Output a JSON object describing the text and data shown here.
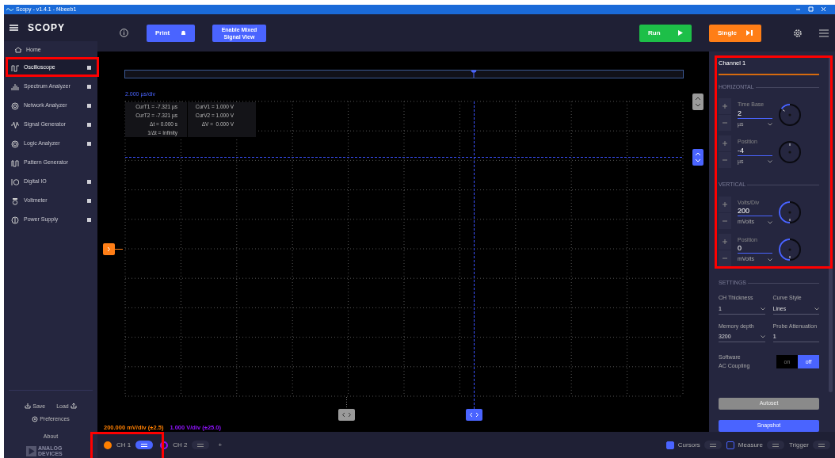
{
  "window": {
    "title": "Scopy - v1.4.1 - f4beeb1"
  },
  "sidebar": {
    "logo": "SCOPY",
    "home": "Home",
    "items": [
      {
        "label": "Oscilloscope",
        "selected": true,
        "indicator": true,
        "kind": "scope"
      },
      {
        "label": "Spectrum Analyzer",
        "selected": false,
        "indicator": true,
        "kind": "spectrum"
      },
      {
        "label": "Network Analyzer",
        "selected": false,
        "indicator": true,
        "kind": "network"
      },
      {
        "label": "Signal Generator",
        "selected": false,
        "indicator": true,
        "kind": "siggen"
      },
      {
        "label": "Logic Analyzer",
        "selected": false,
        "indicator": true,
        "kind": "logic"
      },
      {
        "label": "Pattern Generator",
        "selected": false,
        "indicator": false,
        "kind": "pattern"
      },
      {
        "label": "Digital IO",
        "selected": false,
        "indicator": true,
        "kind": "dio"
      },
      {
        "label": "Voltmeter",
        "selected": false,
        "indicator": true,
        "kind": "voltmeter"
      },
      {
        "label": "Power Supply",
        "selected": false,
        "indicator": true,
        "kind": "power"
      }
    ],
    "save": "Save",
    "load": "Load",
    "preferences": "Preferences",
    "about": "About",
    "vendor": [
      "ANALOG",
      "DEVICES"
    ]
  },
  "toolbar": {
    "print": "Print",
    "mixed_signal": "Enable Mixed Signal View",
    "run": "Run",
    "single": "Single"
  },
  "plot": {
    "time_scale": "2.000 µs/div",
    "cursor_readouts": [
      [
        "CurT1 = -7.321 µs",
        "CurT2 = -7.321 µs",
        "Δt = 0.000 s",
        "1/Δt = Infinity"
      ],
      [
        "CurV1 = 1.000 V",
        "CurV2 = 1.000 V",
        "ΔV =  0.000 V"
      ]
    ],
    "channel_scales": [
      {
        "text": "200.000 mV/div (±2.5)",
        "color": "#ff7f00"
      },
      {
        "text": "1.000 V/div (±25.0)",
        "color": "#9013fe"
      }
    ]
  },
  "panel": {
    "title": "Channel 1",
    "sections": [
      {
        "label": "HORIZONTAL",
        "controls": [
          {
            "label": "Time Base",
            "value": "2",
            "unit": "µs"
          },
          {
            "label": "Position",
            "value": "-4",
            "unit": "µs"
          }
        ]
      },
      {
        "label": "VERTICAL",
        "controls": [
          {
            "label": "Volts/Div",
            "value": "200",
            "unit": "mVolts"
          },
          {
            "label": "Position",
            "value": "0",
            "unit": "mVolts"
          }
        ]
      }
    ],
    "settings_label": "SETTINGS",
    "settings": [
      {
        "label": "CH Thickness",
        "value": "1",
        "kind": "dropdown"
      },
      {
        "label": "Curve Style",
        "value": "Lines",
        "kind": "dropdown"
      },
      {
        "label": "Memory depth",
        "value": "3200",
        "kind": "dropdown"
      },
      {
        "label": "Probe Attenuation",
        "value": "1",
        "kind": "input"
      }
    ],
    "ac_coupling": {
      "label": [
        "Software",
        "AC Coupling"
      ],
      "on_label": "on",
      "off_label": "off",
      "on": false
    },
    "autoset": "Autoset",
    "snapshot": "Snapshot"
  },
  "bottom": {
    "channels": [
      {
        "label": "CH 1",
        "color": "#ff7f00",
        "selected": true
      },
      {
        "label": "CH 2",
        "color": "#9013fe",
        "selected": false
      }
    ],
    "add": "+",
    "menus": [
      {
        "label": "Cursors",
        "checked": true,
        "kind": "check",
        "selected": false
      },
      {
        "label": "Measure",
        "checked": false,
        "kind": "check",
        "selected": false
      },
      {
        "label": "Trigger",
        "kind": "plain",
        "selected": false
      }
    ]
  }
}
